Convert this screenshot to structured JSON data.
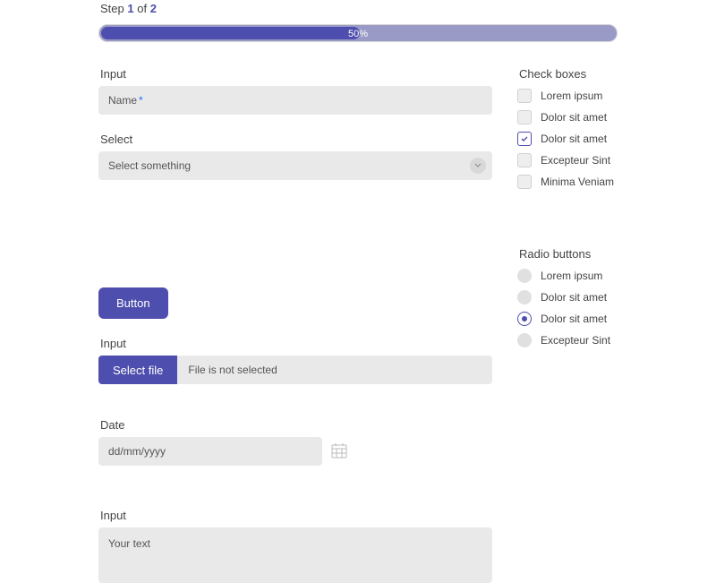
{
  "step": {
    "prefix": "Step",
    "current": "1",
    "of": "of",
    "total": "2"
  },
  "progress": {
    "text": "50%"
  },
  "labels": {
    "input": "Input",
    "select": "Select",
    "checkboxes": "Check boxes",
    "radios": "Radio buttons",
    "file_input": "Input",
    "date": "Date",
    "textarea": "Input"
  },
  "name_field": {
    "placeholder": "Name",
    "required_mark": "*"
  },
  "select_field": {
    "placeholder": "Select something"
  },
  "button": {
    "label": "Button"
  },
  "file_field": {
    "button": "Select file",
    "status": "File is not selected"
  },
  "date_field": {
    "placeholder": "dd/mm/yyyy"
  },
  "textarea": {
    "placeholder": "Your text"
  },
  "checkboxes": [
    {
      "label": "Lorem ipsum",
      "checked": false
    },
    {
      "label": "Dolor sit amet",
      "checked": false
    },
    {
      "label": "Dolor sit amet",
      "checked": true
    },
    {
      "label": "Excepteur Sint",
      "checked": false
    },
    {
      "label": "Minima Veniam",
      "checked": false
    }
  ],
  "radios": [
    {
      "label": "Lorem ipsum",
      "checked": false
    },
    {
      "label": "Dolor sit amet",
      "checked": false
    },
    {
      "label": "Dolor sit amet",
      "checked": true
    },
    {
      "label": "Excepteur Sint",
      "checked": false
    }
  ]
}
